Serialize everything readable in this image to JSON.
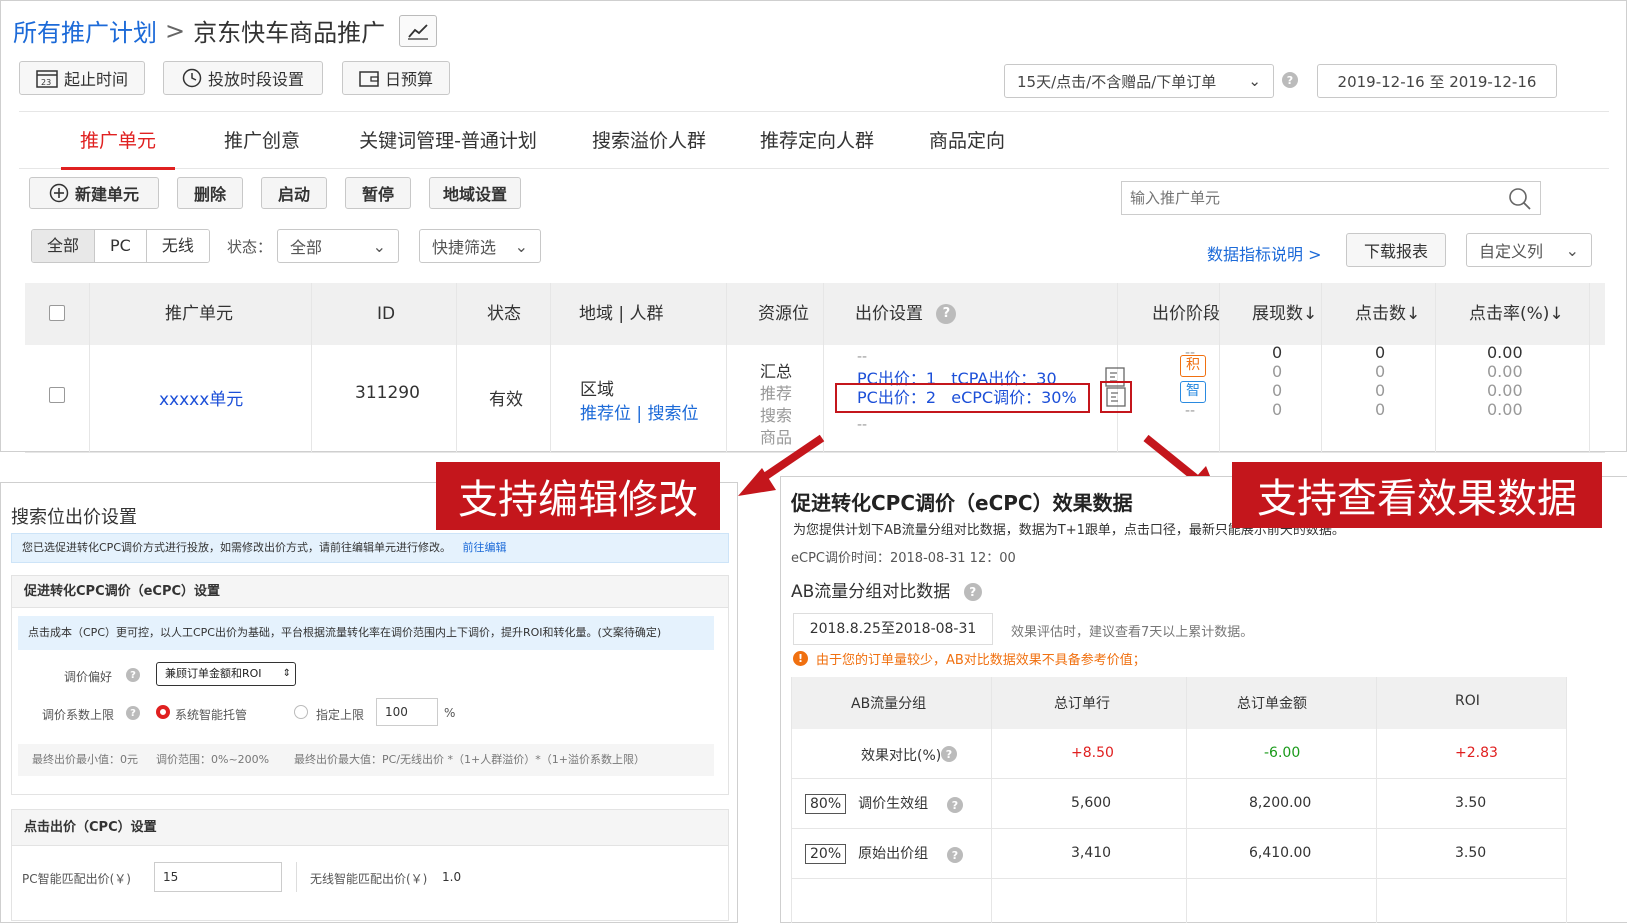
{
  "breadcrumb": {
    "root": "所有推广计划",
    "sep": ">",
    "current": "京东快车商品推广"
  },
  "topButtons": {
    "dateRange": "起止时间",
    "schedule": "投放时段设置",
    "budget": "日预算"
  },
  "attribution": {
    "label": "15天/点击/不含赠品/下单订单"
  },
  "dateDisplay": "2019-12-16 至 2019-12-16",
  "tabs": [
    "推广单元",
    "推广创意",
    "关键词管理-普通计划",
    "搜索溢价人群",
    "推荐定向人群",
    "商品定向"
  ],
  "toolbar": {
    "new": "新建单元",
    "delete": "删除",
    "start": "启动",
    "pause": "暂停",
    "region": "地域设置"
  },
  "search": {
    "placeholder": "输入推广单元"
  },
  "filters": {
    "all": "全部",
    "pc": "PC",
    "mobile": "无线",
    "statusLabel": "状态：",
    "statusValue": "全部",
    "quickFilter": "快捷筛选"
  },
  "links": {
    "metricsHelp": "数据指标说明 >",
    "download": "下载报表",
    "customCols": "自定义列"
  },
  "table": {
    "headers": {
      "unit": "推广单元",
      "id": "ID",
      "status": "状态",
      "region": "地域 | 人群",
      "resource": "资源位",
      "bid": "出价设置",
      "stage": "出价阶段",
      "impressions": "展现数↓",
      "clicks": "点击数↓",
      "ctr": "点击率(%)↓"
    },
    "row": {
      "unit": "xxxxx单元",
      "id": "311290",
      "status": "有效",
      "regionTitle": "区域",
      "regionLink1": "推荐位",
      "regionSep": "|",
      "regionLink2": "搜索位",
      "resources": [
        "汇总",
        "推荐",
        "搜索",
        "商品"
      ],
      "bidDash1": "--",
      "bidLine1": "PC出价：1   tCPA出价：30",
      "bidLine2": "PC出价：2   eCPC调价：30%",
      "bidDash2": "--",
      "stageDash1": "--",
      "stageBadge1": "积",
      "stageBadge2": "智",
      "stageDash2": "--",
      "impressions": [
        "0",
        "0",
        "0",
        "0"
      ],
      "clicks": [
        "0",
        "0",
        "0",
        "0"
      ],
      "ctr": [
        "0.00",
        "0.00",
        "0.00",
        "0.00"
      ]
    }
  },
  "callouts": {
    "left": "支持编辑修改",
    "right": "支持查看效果数据"
  },
  "leftPanel": {
    "title": "搜索位出价设置",
    "notice": "您已选促进转化CPC调价方式进行投放，如需修改出价方式，请前往编辑单元进行修改。",
    "noticeLink": "前往编辑",
    "ecpcSectionTitle": "促进转化CPC调价（eCPC）设置",
    "ecpcDesc": "点击成本（CPC）更可控，以人工CPC出价为基础，平台根据流量转化率在调价范围内上下调价，提升ROI和转化量。(文案待确定)",
    "prefLabel": "调价偏好",
    "prefValue": "兼顾订单金额和ROI",
    "capLabel": "调价系数上限",
    "capOption1": "系统智能托管",
    "capOption2": "指定上限",
    "capValue": "100",
    "capUnit": "%",
    "footMin": "最终出价最小值：0元",
    "footRange": "调价范围：0%~200%",
    "footMax": "最终出价最大值：PC/无线出价 *（1+人群溢价）*（1+溢价系数上限）",
    "cpcSectionTitle": "点击出价（CPC）设置",
    "pcBidLabel": "PC智能匹配出价(￥)",
    "pcBidValue": "15",
    "mobileBidLabel": "无线智能匹配出价(￥)",
    "mobileBidValue": "1.0"
  },
  "rightPanel": {
    "title": "促进转化CPC调价（eCPC）效果数据",
    "desc": "为您提供计划下AB流量分组对比数据，数据为T+1跟单，点击口径，最新只能展示前天的数据。",
    "time": "eCPC调价时间：2018-08-31 12：00",
    "abTitle": "AB流量分组对比数据",
    "dateRange": "2018.8.25至2018-08-31",
    "evalHint": "效果评估时，建议查看7天以上累计数据。",
    "warning": "由于您的订单量较少，AB对比数据效果不具备参考价值；",
    "headers": [
      "AB流量分组",
      "总订单行",
      "总订单金额",
      "ROI"
    ],
    "compareLabel": "效果对比(%)",
    "compare": [
      "+8.50",
      "-6.00",
      "+2.83"
    ],
    "rows": [
      {
        "pct": "80%",
        "name": "调价生效组",
        "values": [
          "5,600",
          "8,200.00",
          "3.50"
        ]
      },
      {
        "pct": "20%",
        "name": "原始出价组",
        "values": [
          "3,410",
          "6,410.00",
          "3.50"
        ]
      }
    ]
  },
  "colors": {
    "accentRed": "#e02020",
    "link": "#1c6ad8",
    "callout": "#c4161c",
    "positive": "#e02020",
    "negative": "#1a9a1a",
    "warning": "#f07010"
  }
}
